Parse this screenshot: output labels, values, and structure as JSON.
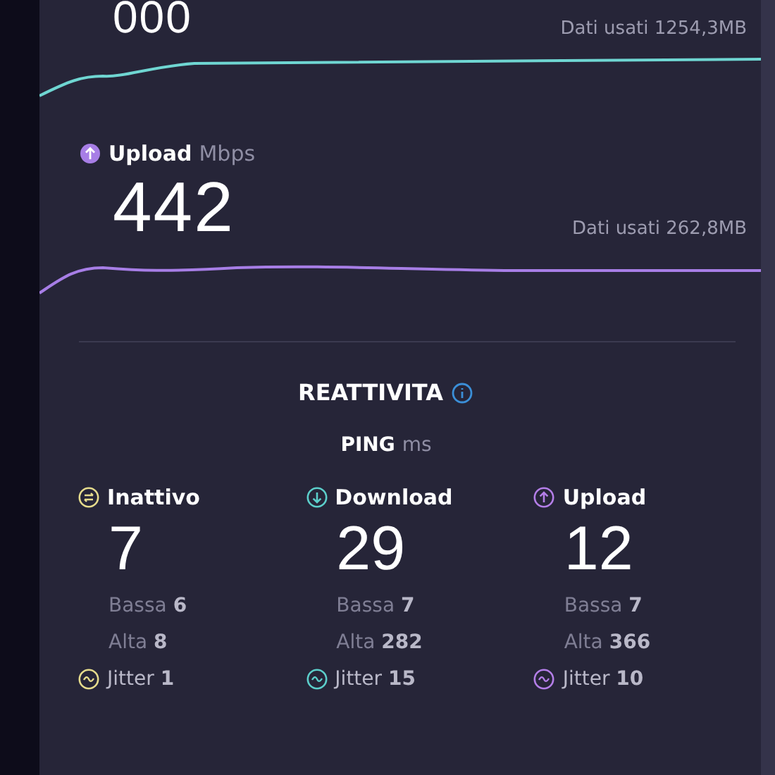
{
  "download": {
    "value": "000",
    "data_used": "Dati usati 1254,3MB",
    "color": "#6fd6d2"
  },
  "upload": {
    "label": "Upload",
    "unit": "Mbps",
    "value": "442",
    "data_used": "Dati usati 262,8MB",
    "color": "#a77ee6"
  },
  "responsiveness": {
    "title": "REATTIVITA",
    "ping_label": "PING",
    "ping_unit": "ms",
    "columns": [
      {
        "kind": "idle",
        "label": "Inattivo",
        "value": "7",
        "low_label": "Bassa",
        "low": "6",
        "high_label": "Alta",
        "high": "8",
        "jitter_label": "Jitter",
        "jitter": "1",
        "color": "#e6dc8c"
      },
      {
        "kind": "download",
        "label": "Download",
        "value": "29",
        "low_label": "Bassa",
        "low": "7",
        "high_label": "Alta",
        "high": "282",
        "jitter_label": "Jitter",
        "jitter": "15",
        "color": "#5ccfcb"
      },
      {
        "kind": "upload",
        "label": "Upload",
        "value": "12",
        "low_label": "Bassa",
        "low": "7",
        "high_label": "Alta",
        "high": "366",
        "jitter_label": "Jitter",
        "jitter": "10",
        "color": "#b47ee8"
      }
    ]
  }
}
